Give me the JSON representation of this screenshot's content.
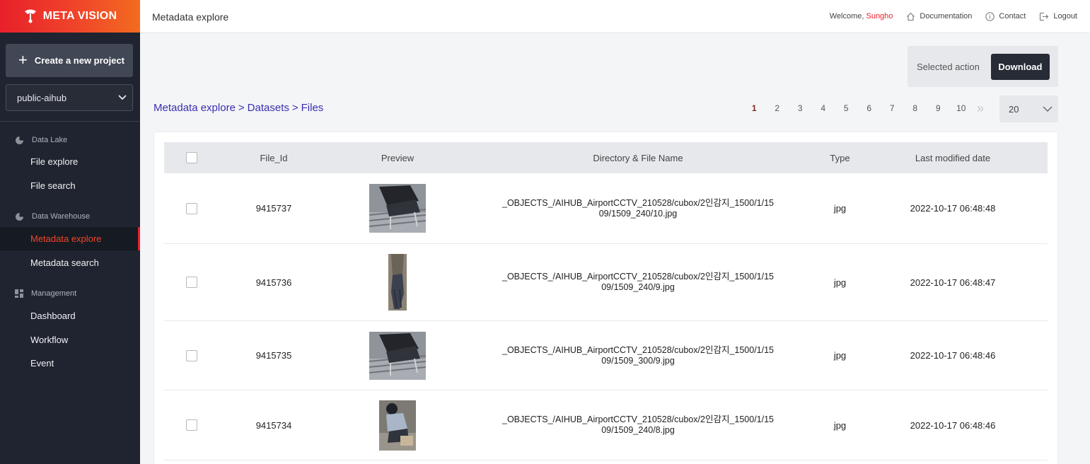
{
  "brand": {
    "name": "META VISION"
  },
  "sidebar": {
    "create_label": "Create a new project",
    "project": "public-aihub",
    "sections": [
      {
        "label": "Data Lake",
        "items": [
          {
            "label": "File explore"
          },
          {
            "label": "File search"
          }
        ]
      },
      {
        "label": "Data Warehouse",
        "items": [
          {
            "label": "Metadata explore",
            "active": true
          },
          {
            "label": "Metadata search"
          }
        ]
      },
      {
        "label": "Management",
        "items": [
          {
            "label": "Dashboard"
          },
          {
            "label": "Workflow"
          },
          {
            "label": "Event"
          }
        ]
      }
    ]
  },
  "header": {
    "title": "Metadata explore",
    "welcome": "Welcome,",
    "user": "Sungho",
    "documentation": "Documentation",
    "contact": "Contact",
    "logout": "Logout"
  },
  "actions": {
    "label": "Selected action",
    "download": "Download"
  },
  "breadcrumb": [
    "Metadata explore",
    ">",
    "Datasets",
    ">",
    "Files"
  ],
  "pagination": {
    "pages": [
      "1",
      "2",
      "3",
      "4",
      "5",
      "6",
      "7",
      "8",
      "9",
      "10"
    ],
    "current": "1",
    "per_page": "20"
  },
  "table": {
    "columns": [
      "File_Id",
      "Preview",
      "Directory & File Name",
      "Type",
      "Last modified date"
    ],
    "rows": [
      {
        "id": "9415737",
        "path": "_OBJECTS_/AIHUB_AirportCCTV_210528/cubox/2인감지_1500/1/1509/1509_240/10.jpg",
        "type": "jpg",
        "date": "2022-10-17 06:48:48",
        "preview": "chairs-wide"
      },
      {
        "id": "9415736",
        "path": "_OBJECTS_/AIHUB_AirportCCTV_210528/cubox/2인감지_1500/1/1509/1509_240/9.jpg",
        "type": "jpg",
        "date": "2022-10-17 06:48:47",
        "preview": "person-narrow"
      },
      {
        "id": "9415735",
        "path": "_OBJECTS_/AIHUB_AirportCCTV_210528/cubox/2인감지_1500/1/1509/1509_300/9.jpg",
        "type": "jpg",
        "date": "2022-10-17 06:48:46",
        "preview": "chairs-wide"
      },
      {
        "id": "9415734",
        "path": "_OBJECTS_/AIHUB_AirportCCTV_210528/cubox/2인감지_1500/1/1509/1509_240/8.jpg",
        "type": "jpg",
        "date": "2022-10-17 06:48:46",
        "preview": "person-box"
      }
    ]
  },
  "colors": {
    "accent": "#e8202a",
    "sidebar": "#1f2430",
    "link": "#3a2fb0"
  }
}
